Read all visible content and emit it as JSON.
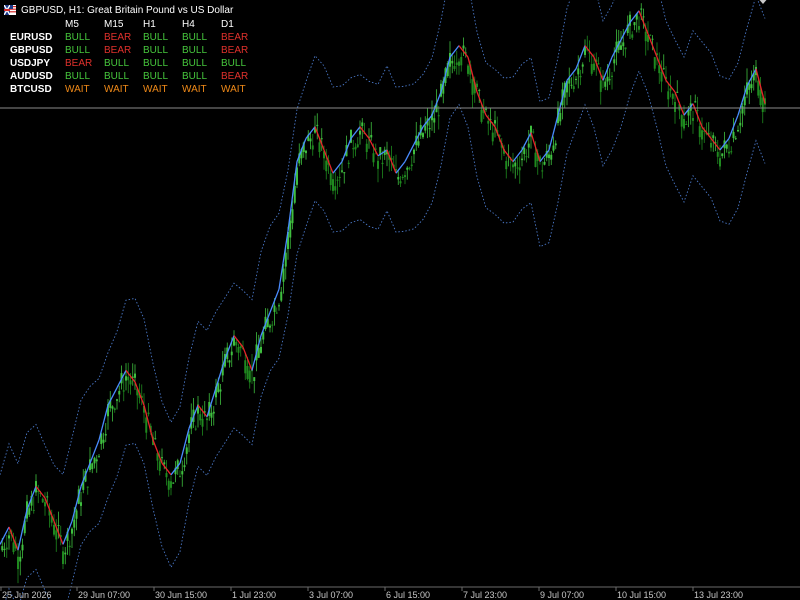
{
  "window": {
    "title": "GBPUSD, H1:  Great Britain Pound vs US Dollar",
    "symbol_icon": "flag-uk-us-icon"
  },
  "dashboard": {
    "timeframes": [
      "M5",
      "M15",
      "H1",
      "H4",
      "D1"
    ],
    "rows": [
      {
        "symbol": "EURUSD",
        "signals": [
          "BULL",
          "BEAR",
          "BULL",
          "BULL",
          "BEAR"
        ]
      },
      {
        "symbol": "GBPUSD",
        "signals": [
          "BULL",
          "BEAR",
          "BULL",
          "BULL",
          "BEAR"
        ]
      },
      {
        "symbol": "USDJPY",
        "signals": [
          "BEAR",
          "BULL",
          "BULL",
          "BULL",
          "BULL"
        ]
      },
      {
        "symbol": "AUDUSD",
        "signals": [
          "BULL",
          "BULL",
          "BULL",
          "BULL",
          "BEAR"
        ]
      },
      {
        "symbol": "BTCUSD",
        "signals": [
          "WAIT",
          "WAIT",
          "WAIT",
          "WAIT",
          "WAIT"
        ]
      }
    ],
    "colors": {
      "BULL": "#46c63c",
      "BEAR": "#e0312c",
      "WAIT": "#f08a18"
    }
  },
  "time_axis": {
    "labels": [
      "25 Jun 2026",
      "29 Jun 07:00",
      "30 Jun 15:00",
      "1 Jul 23:00",
      "3 Jul 07:00",
      "6 Jul 15:00",
      "7 Jul 23:00",
      "9 Jul 07:00",
      "10 Jul 15:00",
      "13 Jul 23:00"
    ]
  },
  "chart_data": {
    "type": "line",
    "symbol": "GBPUSD",
    "timeframe": "H1",
    "candles_color_bull": "#3fbf3f",
    "candles_color_bear": "#1f8a1f",
    "trend_line_colors": {
      "up": "#4a8cff",
      "down": "#e8232a"
    },
    "envelope_color": "#4a78c8",
    "current_price_line": true,
    "price_axis_visible": false,
    "x_ticks": [
      "25 Jun 2026",
      "29 Jun 07:00",
      "30 Jun 15:00",
      "1 Jul 23:00",
      "3 Jul 07:00",
      "6 Jul 15:00",
      "7 Jul 23:00",
      "9 Jul 07:00",
      "10 Jul 15:00",
      "13 Jul 23:00"
    ],
    "relative_close_series": [
      0.06,
      0.09,
      0.05,
      0.12,
      0.16,
      0.14,
      0.1,
      0.06,
      0.1,
      0.16,
      0.2,
      0.24,
      0.3,
      0.33,
      0.36,
      0.34,
      0.3,
      0.24,
      0.2,
      0.18,
      0.2,
      0.26,
      0.3,
      0.28,
      0.33,
      0.38,
      0.42,
      0.4,
      0.36,
      0.42,
      0.46,
      0.5,
      0.6,
      0.72,
      0.76,
      0.78,
      0.74,
      0.7,
      0.72,
      0.76,
      0.78,
      0.76,
      0.73,
      0.74,
      0.7,
      0.72,
      0.75,
      0.78,
      0.8,
      0.84,
      0.9,
      0.92,
      0.9,
      0.84,
      0.8,
      0.78,
      0.74,
      0.72,
      0.74,
      0.77,
      0.72,
      0.74,
      0.8,
      0.86,
      0.88,
      0.92,
      0.9,
      0.86,
      0.9,
      0.93,
      0.96,
      0.98,
      0.94,
      0.9,
      0.86,
      0.84,
      0.8,
      0.82,
      0.78,
      0.76,
      0.74,
      0.76,
      0.8,
      0.85,
      0.88,
      0.82
    ]
  }
}
